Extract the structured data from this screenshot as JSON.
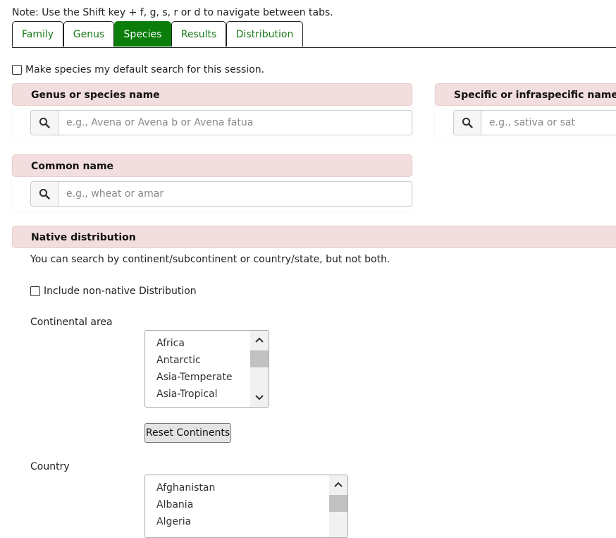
{
  "note": "Note: Use the Shift key + f, g, s, r or d to navigate between tabs.",
  "tabs": [
    {
      "label": "Family"
    },
    {
      "label": "Genus"
    },
    {
      "label": "Species",
      "active": true
    },
    {
      "label": "Results"
    },
    {
      "label": "Distribution"
    }
  ],
  "default_search_label": "Make species my default search for this session.",
  "genus_panel": {
    "title": "Genus or species name",
    "placeholder": "e.g., Avena or Avena b or Avena fatua"
  },
  "specific_panel": {
    "title": "Specific or infraspecific name",
    "placeholder": "e.g., sativa or sat"
  },
  "common_panel": {
    "title": "Common name",
    "placeholder": "e.g., wheat or amar"
  },
  "native_panel": {
    "title": "Native distribution",
    "help": "You can search by continent/subcontinent or country/state, but not both.",
    "include_label": "Include non-native Distribution",
    "continental_label": "Continental area",
    "continents": [
      "Africa",
      "Antarctic",
      "Asia-Temperate",
      "Asia-Tropical"
    ],
    "reset_label": "Reset Continents",
    "country_label": "Country",
    "countries": [
      "Afghanistan",
      "Albania",
      "Algeria"
    ]
  },
  "colors": {
    "tab_active": "#0a7d0a",
    "tab_text": "#1a7a1a",
    "panel_header": "#f2dede"
  }
}
